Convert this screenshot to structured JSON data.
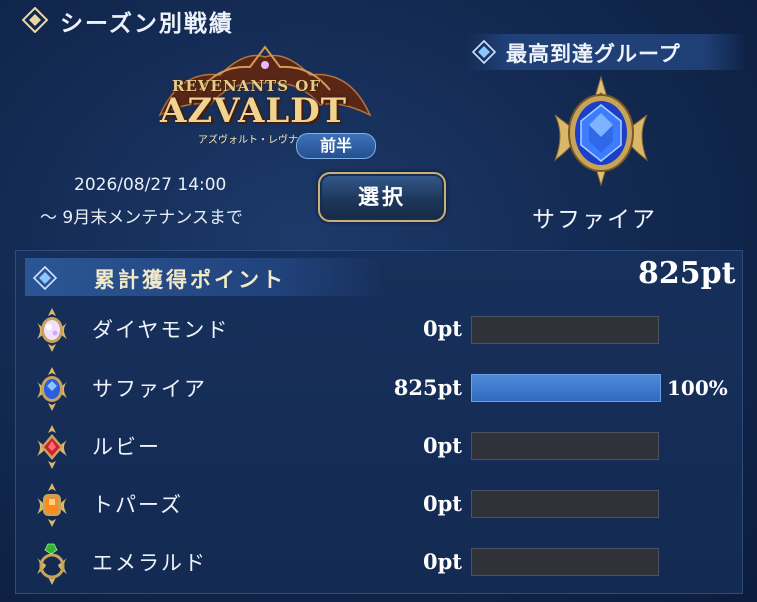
{
  "header": {
    "title": "シーズン別戦績"
  },
  "season": {
    "logo_top": "REVENANTS OF",
    "logo_main": "AZVALDT",
    "logo_sub": "アズヴォルト・レヴナント",
    "half_badge": "前半",
    "date_line1": "2026/08/27 14:00",
    "date_line2": "〜 9月末メンテナンスまで",
    "select_label": "選択"
  },
  "top_group": {
    "title": "最高到達グループ",
    "name": "サファイア",
    "icon": "sapphire-emblem-icon"
  },
  "points": {
    "title": "累計獲得ポイント",
    "total": "825pt",
    "rows": [
      {
        "label": "ダイヤモンド",
        "value": "0pt",
        "progress": 0,
        "percent": "",
        "icon": "diamond-gem-icon",
        "color": "#e9d4ff"
      },
      {
        "label": "サファイア",
        "value": "825pt",
        "progress": 1.0,
        "percent": "100%",
        "icon": "sapphire-gem-icon",
        "color": "#3d7cff"
      },
      {
        "label": "ルビー",
        "value": "0pt",
        "progress": 0,
        "percent": "",
        "icon": "ruby-gem-icon",
        "color": "#e0283a"
      },
      {
        "label": "トパーズ",
        "value": "0pt",
        "progress": 0,
        "percent": "",
        "icon": "topaz-gem-icon",
        "color": "#ff8a1a"
      },
      {
        "label": "エメラルド",
        "value": "0pt",
        "progress": 0,
        "percent": "",
        "icon": "emerald-gem-icon",
        "color": "#38c23a"
      }
    ]
  },
  "colors": {
    "accent_gold": "#c9b07a",
    "bar_fill": "#3a78d0",
    "bar_empty": "#2f3339"
  }
}
